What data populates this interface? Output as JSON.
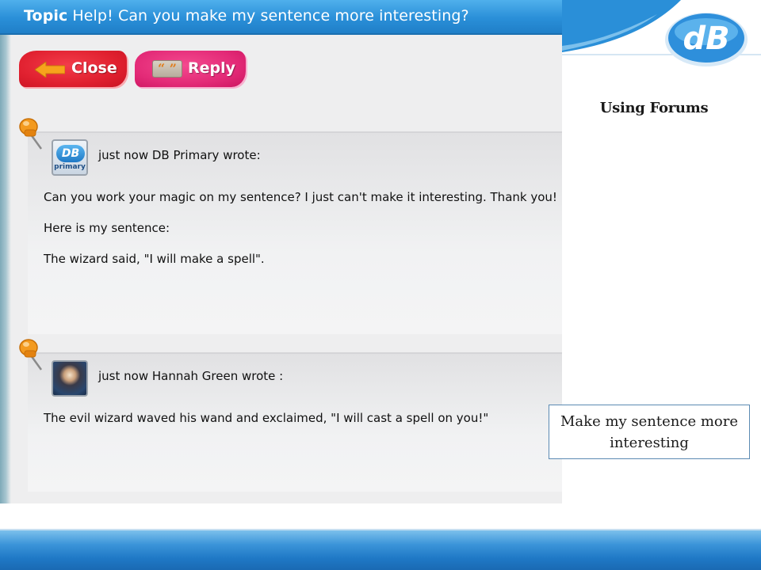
{
  "topic": {
    "prefix": "Topic",
    "title": "Help! Can you make my sentence more interesting?"
  },
  "toolbar": {
    "close_label": "Close",
    "reply_label": "Reply"
  },
  "posts": [
    {
      "meta": "just now DB Primary wrote:",
      "avatar_text": "DB",
      "avatar_caption": "primary",
      "lines": [
        "Can you work your magic on my sentence? I just can't make it interesting. Thank you!",
        "Here is my sentence:",
        "The wizard said, \"I will make a spell\"."
      ]
    },
    {
      "meta": "just now Hannah Green wrote :",
      "lines": [
        "The evil wizard waved his wand and exclaimed, \"I will cast a spell on you!\""
      ]
    }
  ],
  "sidebar": {
    "logo_text": "dB",
    "page_title": "Using Forums",
    "note": "Make my sentence more interesting"
  },
  "colors": {
    "topic_bar": "#2a8fd8",
    "close_button": "#e0202f",
    "reply_button": "#e32a77",
    "note_border": "#5b8ab3",
    "footer": "#1f79c6"
  },
  "icons": {
    "close": "arrow-left-icon",
    "reply": "quote-icon",
    "post": "pushpin-icon"
  }
}
